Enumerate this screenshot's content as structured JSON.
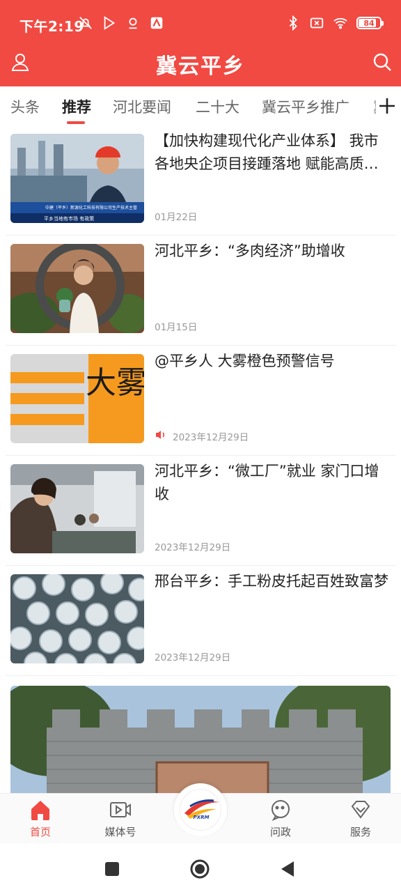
{
  "status_bar": {
    "time": "下午2:19",
    "battery": "84",
    "battery_level": 0.84,
    "left_icons": [
      "mute-icon",
      "play-store-icon",
      "location-icon",
      "app-notification-icon"
    ],
    "right_icons": [
      "bluetooth-icon",
      "no-sim-icon",
      "wifi-icon",
      "battery-icon"
    ]
  },
  "header": {
    "title": "冀云平乡",
    "left_icon": "user-icon",
    "right_icon": "search-icon",
    "bg_color": "#f04a43"
  },
  "tabs": {
    "items": [
      {
        "label": "头条"
      },
      {
        "label": "推荐"
      },
      {
        "label": "河北要闻"
      },
      {
        "label": "二十大"
      },
      {
        "label": "冀云平乡推广"
      },
      {
        "label": "冀"
      }
    ],
    "active_index": 1,
    "add_icon": "plus-icon"
  },
  "feed": [
    {
      "title": "【加快构建现代化产业体系】 我市各地央企项目接踵落地 赋能高质…",
      "date": "01月22日",
      "has_audio": false,
      "thumb_caption_1": "中建（平乡）新源化工科技有限公司生产技术主管",
      "thumb_caption_2": "平乡当地有市场 有政策"
    },
    {
      "title": "河北平乡：“多肉经济”助增收",
      "date": "01月15日",
      "has_audio": false
    },
    {
      "title": "@平乡人 大雾橙色预警信号",
      "date": "2023年12月29日",
      "has_audio": true,
      "thumb_text": "大雾"
    },
    {
      "title": "河北平乡：“微工厂”就业 家门口增收",
      "date": "2023年12月29日",
      "has_audio": false
    },
    {
      "title": "邢台平乡：手工粉皮托起百姓致富梦",
      "date": "2023年12月29日",
      "has_audio": false
    }
  ],
  "bottom_nav": {
    "items": [
      {
        "label": "首页",
        "icon": "home-icon"
      },
      {
        "label": "媒体号",
        "icon": "video-icon"
      },
      {
        "label": "问政",
        "icon": "chat-icon"
      },
      {
        "label": "服务",
        "icon": "service-icon"
      }
    ],
    "active_index": 0,
    "center_logo_text": "PXRM"
  },
  "system_nav": {
    "icons": [
      "recents-icon",
      "home-circle-icon",
      "back-icon"
    ]
  }
}
